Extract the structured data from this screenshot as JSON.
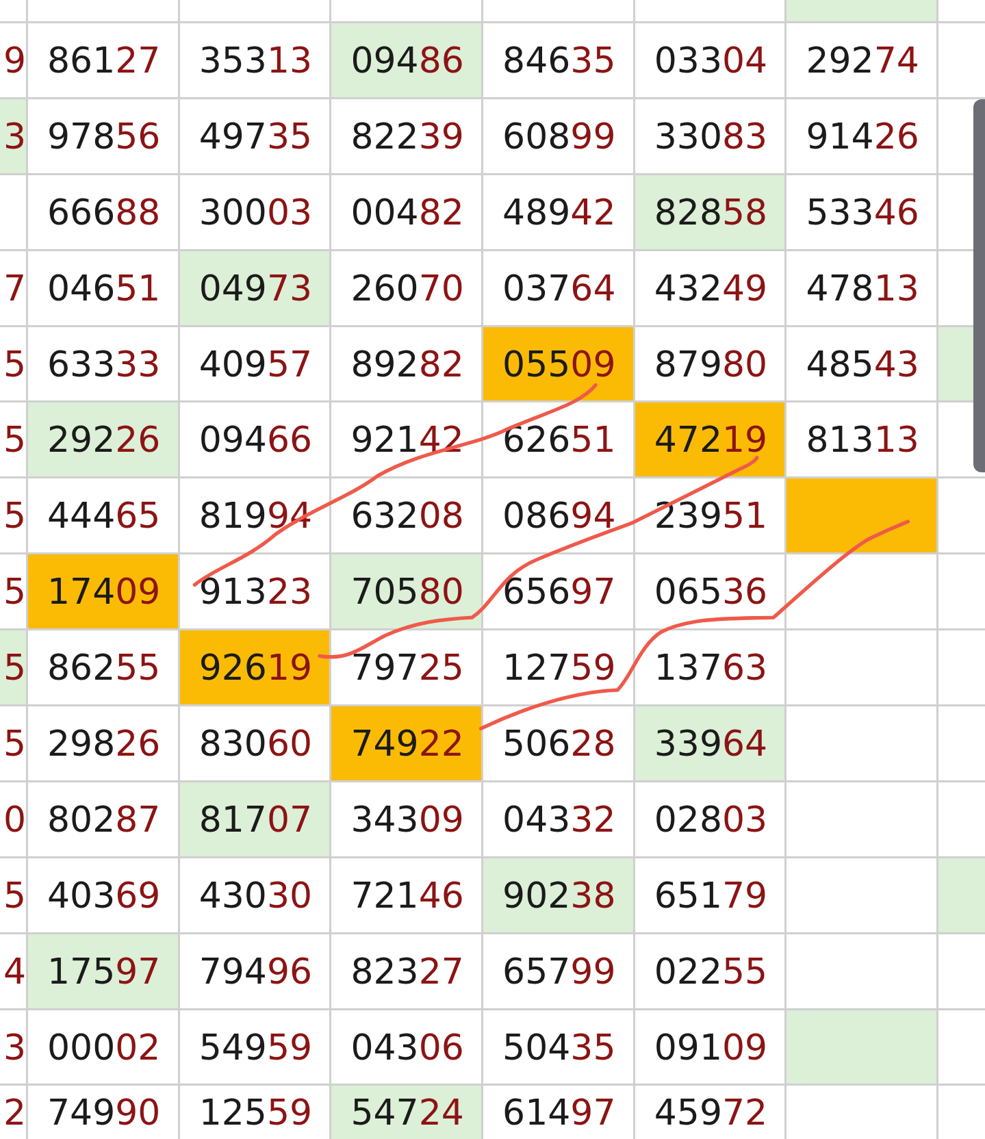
{
  "rows": [
    {
      "left": {},
      "cells": [
        {},
        {},
        {},
        {},
        {},
        {
          "color": "#dcefd7"
        }
      ],
      "right": {}
    },
    {
      "left": {
        "value": "9"
      },
      "cells": [
        {
          "value": "86127"
        },
        {
          "value": "35313"
        },
        {
          "value": "09486",
          "color": "#dcefd7"
        },
        {
          "value": "84635"
        },
        {
          "value": "03304"
        },
        {
          "value": "29274"
        }
      ],
      "right": {}
    },
    {
      "left": {
        "value": "3",
        "color": "#dcefd7"
      },
      "cells": [
        {
          "value": "97856"
        },
        {
          "value": "49735"
        },
        {
          "value": "82239"
        },
        {
          "value": "60899"
        },
        {
          "value": "33083"
        },
        {
          "value": "91426"
        }
      ],
      "right": {}
    },
    {
      "left": {},
      "cells": [
        {
          "value": "66688"
        },
        {
          "value": "30003"
        },
        {
          "value": "00482"
        },
        {
          "value": "48942"
        },
        {
          "value": "82858",
          "color": "#dcefd7"
        },
        {
          "value": "53346"
        }
      ],
      "right": {}
    },
    {
      "left": {
        "value": "7"
      },
      "cells": [
        {
          "value": "04651"
        },
        {
          "value": "04973",
          "color": "#dcefd7"
        },
        {
          "value": "26070"
        },
        {
          "value": "03764"
        },
        {
          "value": "43249"
        },
        {
          "value": "47813"
        }
      ],
      "right": {}
    },
    {
      "left": {
        "value": "5"
      },
      "cells": [
        {
          "value": "63333"
        },
        {
          "value": "40957"
        },
        {
          "value": "89282"
        },
        {
          "value": "05509",
          "color": "#fbbb05"
        },
        {
          "value": "87980"
        },
        {
          "value": "48543"
        }
      ],
      "right": {
        "color": "#dcefd7"
      }
    },
    {
      "left": {
        "value": "5"
      },
      "cells": [
        {
          "value": "29226",
          "color": "#dcefd7"
        },
        {
          "value": "09466"
        },
        {
          "value": "92142"
        },
        {
          "value": "62651"
        },
        {
          "value": "47219",
          "color": "#fbbb05"
        },
        {
          "value": "81313"
        }
      ],
      "right": {}
    },
    {
      "left": {
        "value": "5"
      },
      "cells": [
        {
          "value": "44465"
        },
        {
          "value": "81994"
        },
        {
          "value": "63208"
        },
        {
          "value": "08694"
        },
        {
          "value": "23951"
        },
        {
          "color": "#fbbb05"
        }
      ],
      "right": {}
    },
    {
      "left": {
        "value": "5"
      },
      "cells": [
        {
          "value": "17409",
          "color": "#fbbb05"
        },
        {
          "value": "91323"
        },
        {
          "value": "70580",
          "color": "#dcefd7"
        },
        {
          "value": "65697"
        },
        {
          "value": "06536"
        },
        {}
      ],
      "right": {}
    },
    {
      "left": {
        "value": "5",
        "color": "#dcefd7"
      },
      "cells": [
        {
          "value": "86255"
        },
        {
          "value": "92619",
          "color": "#fbbb05"
        },
        {
          "value": "79725"
        },
        {
          "value": "12759"
        },
        {
          "value": "13763"
        },
        {}
      ],
      "right": {}
    },
    {
      "left": {
        "value": "5"
      },
      "cells": [
        {
          "value": "29826"
        },
        {
          "value": "83060"
        },
        {
          "value": "74922",
          "color": "#fbbb05"
        },
        {
          "value": "50628"
        },
        {
          "value": "33964",
          "color": "#dcefd7"
        },
        {}
      ],
      "right": {}
    },
    {
      "left": {
        "value": "0"
      },
      "cells": [
        {
          "value": "80287"
        },
        {
          "value": "81707",
          "color": "#dcefd7"
        },
        {
          "value": "34309"
        },
        {
          "value": "04332"
        },
        {
          "value": "02803"
        },
        {}
      ],
      "right": {}
    },
    {
      "left": {
        "value": "5"
      },
      "cells": [
        {
          "value": "40369"
        },
        {
          "value": "43030"
        },
        {
          "value": "72146"
        },
        {
          "value": "90238",
          "color": "#dcefd7"
        },
        {
          "value": "65179"
        },
        {}
      ],
      "right": {
        "color": "#dcefd7"
      }
    },
    {
      "left": {
        "value": "4"
      },
      "cells": [
        {
          "value": "17597",
          "color": "#dcefd7"
        },
        {
          "value": "79496"
        },
        {
          "value": "82327"
        },
        {
          "value": "65799"
        },
        {
          "value": "02255"
        },
        {}
      ],
      "right": {}
    },
    {
      "left": {
        "value": "3"
      },
      "cells": [
        {
          "value": "00002"
        },
        {
          "value": "54959"
        },
        {
          "value": "04306"
        },
        {
          "value": "50435"
        },
        {
          "value": "09109"
        },
        {
          "color": "#dcefd7"
        }
      ],
      "right": {}
    },
    {
      "left": {
        "value": "2"
      },
      "cells": [
        {
          "value": "74990"
        },
        {
          "value": "12559"
        },
        {
          "value": "54724",
          "color": "#dcefd7"
        },
        {
          "value": "61497"
        },
        {
          "value": "45972"
        },
        {}
      ],
      "right": {}
    }
  ]
}
